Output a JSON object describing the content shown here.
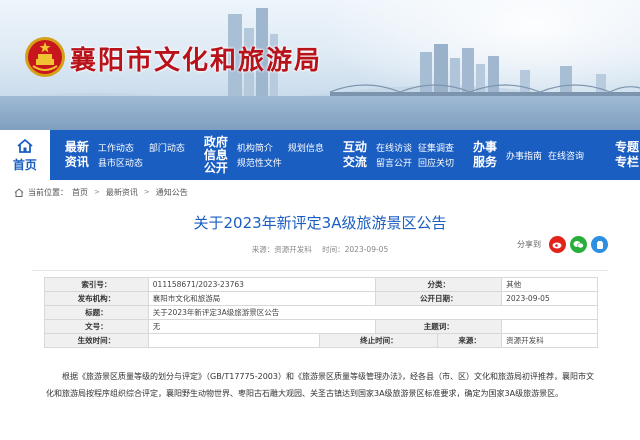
{
  "header": {
    "site_title": "襄阳市文化和旅游局"
  },
  "nav": {
    "home_label": "首页",
    "groups": [
      {
        "title": "最新资讯",
        "items": [
          "工作动态",
          "部门动态",
          "县市区动态"
        ]
      },
      {
        "title": "政府信息公开",
        "items": [
          "机构简介",
          "规划信息",
          "规范性文件"
        ]
      },
      {
        "title": "互动交流",
        "items": [
          "在线访谈",
          "征集调查",
          "留言公开",
          "回应关切"
        ]
      },
      {
        "title": "办事服务",
        "items": [
          "办事指南",
          "在线咨询"
        ]
      },
      {
        "title": "专题专栏",
        "items": []
      }
    ]
  },
  "breadcrumb": {
    "prefix": "当前位置：",
    "items": [
      "首页",
      "最新资讯",
      "通知公告"
    ]
  },
  "article": {
    "title": "关于2023年新评定3A级旅游景区公告",
    "source": "来源：资源开发科",
    "date": "时间：2023-09-05",
    "share_label": "分享到"
  },
  "info_table": {
    "index_key": "索引号：",
    "index_val": "011158671/2023-23763",
    "category_key": "分类：",
    "category_val": "其他",
    "publisher_key": "发布机构：",
    "publisher_val": "襄阳市文化和旅游局",
    "pubdate_key": "公开日期：",
    "pubdate_val": "2023-09-05",
    "title_key": "标题：",
    "title_val": "关于2023年新评定3A级旅游景区公告",
    "docno_key": "文号：",
    "docno_val": "无",
    "topic_key": "主题词：",
    "topic_val": "",
    "effective_key": "生效时间：",
    "effective_val": "",
    "expire_key": "终止时间：",
    "expire_val": "",
    "source_key": "来源：",
    "source_val": "资源开发科"
  },
  "body": {
    "paragraph": "根据《旅游景区质量等级的划分与评定》（GB/T17775-2003）和《旅游景区质量等级管理办法》，经各县（市、区）文化和旅游局初评推荐，襄阳市文化和旅游局按程序组织综合评定，襄阳野生动物世界、枣阳古石雕大观园、关圣古镇达到国家3A级旅游景区标准要求，确定为国家3A级旅游景区。"
  },
  "colors": {
    "brand_blue": "#1a5ec2",
    "title_red": "#b8121b"
  },
  "icons": [
    "emblem-icon",
    "home-icon",
    "house-icon",
    "chevron-icon",
    "wechat-icon",
    "weibo-icon",
    "qzone-icon"
  ]
}
